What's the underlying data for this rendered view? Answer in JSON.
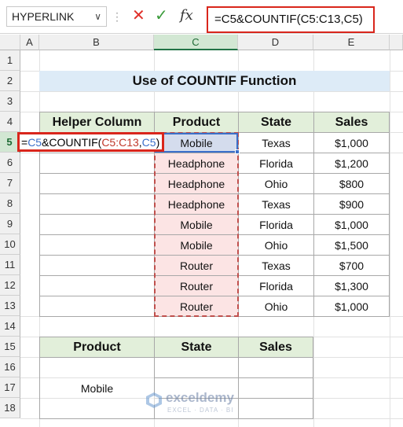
{
  "formula_bar": {
    "name_box": "HYPERLINK",
    "formula": "=C5&COUNTIF(C5:C13,C5)",
    "cancel_icon": "close-icon",
    "enter_icon": "check-icon",
    "fx_label": "fx"
  },
  "columns": [
    "A",
    "B",
    "C",
    "D",
    "E"
  ],
  "rows": [
    "1",
    "2",
    "3",
    "4",
    "5",
    "6",
    "7",
    "8",
    "9",
    "10",
    "11",
    "12",
    "13",
    "14",
    "15",
    "16",
    "17",
    "18"
  ],
  "title": "Use of COUNTIF Function",
  "table": {
    "headers": [
      "Helper Column",
      "Product",
      "State",
      "Sales"
    ],
    "edit_parts": {
      "eq": "=",
      "ref1": "C5",
      "mid": "&COUNTIF(",
      "range": "C5:C13",
      "comma": ",",
      "ref2": "C5",
      "close": ")"
    },
    "rows": [
      {
        "product": "Mobile",
        "state": "Texas",
        "sales": "$1,000"
      },
      {
        "product": "Headphone",
        "state": "Florida",
        "sales": "$1,200"
      },
      {
        "product": "Headphone",
        "state": "Ohio",
        "sales": "$800"
      },
      {
        "product": "Headphone",
        "state": "Texas",
        "sales": "$900"
      },
      {
        "product": "Mobile",
        "state": "Florida",
        "sales": "$1,000"
      },
      {
        "product": "Mobile",
        "state": "Ohio",
        "sales": "$1,500"
      },
      {
        "product": "Router",
        "state": "Texas",
        "sales": "$700"
      },
      {
        "product": "Router",
        "state": "Florida",
        "sales": "$1,300"
      },
      {
        "product": "Router",
        "state": "Ohio",
        "sales": "$1,000"
      }
    ]
  },
  "lookup": {
    "headers": [
      "Product",
      "State",
      "Sales"
    ],
    "product_value": "Mobile"
  },
  "watermark": {
    "name": "exceldemy",
    "tagline": "EXCEL · DATA · BI"
  },
  "colors": {
    "accent_red": "#d9261c",
    "header_green": "#e2efda",
    "title_blue": "#ddebf7",
    "range_pink": "#fce4e4"
  }
}
